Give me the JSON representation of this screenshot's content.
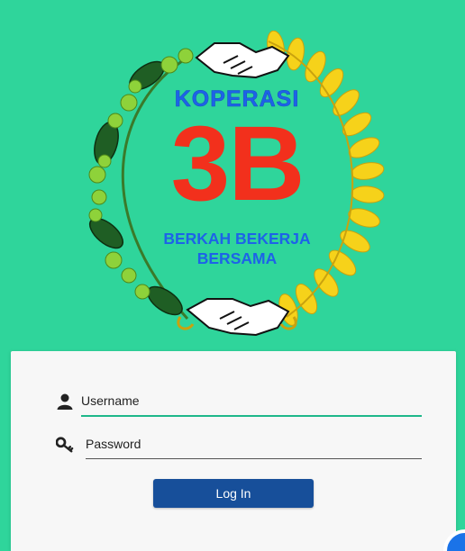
{
  "logo": {
    "title": "KOPERASI",
    "mark": "3B",
    "tagline_line1": "BERKAH BEKERJA",
    "tagline_line2": "BERSAMA",
    "colors": {
      "background": "#2fd59b",
      "koperasi_text": "#1d63e8",
      "mark_text": "#f2301c",
      "rice_wreath": "#f6d21a",
      "leaf_wreath": "#2e8b3a"
    },
    "icons": [
      "handshake-icon",
      "rice-wreath-icon",
      "leaf-wreath-icon"
    ]
  },
  "login": {
    "username_placeholder": "Username",
    "password_placeholder": "Password",
    "submit_label": "Log In",
    "icons": {
      "username": "user-icon",
      "password": "key-icon"
    },
    "colors": {
      "button": "#174f9a",
      "active_underline": "#1fb88a"
    }
  }
}
